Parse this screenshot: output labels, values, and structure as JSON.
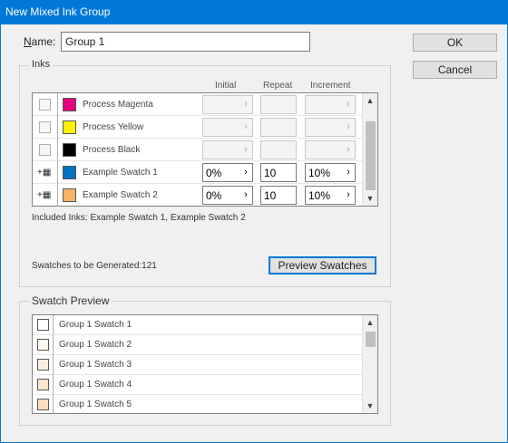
{
  "window": {
    "title": "New Mixed Ink Group"
  },
  "name": {
    "label": "Name:",
    "label_mnemonic": "N",
    "label_rest": "ame:",
    "value": "Group 1"
  },
  "buttons": {
    "ok": "OK",
    "cancel": "Cancel",
    "preview": "Preview Swatches"
  },
  "inks": {
    "title": "Inks",
    "columns": [
      "Initial",
      "Repeat",
      "Increment"
    ],
    "rows": [
      {
        "name": "Process Magenta",
        "color": "#e6007e",
        "included": false,
        "initial": "",
        "repeat": "",
        "increment": ""
      },
      {
        "name": "Process Yellow",
        "color": "#fff200",
        "included": false,
        "initial": "",
        "repeat": "",
        "increment": ""
      },
      {
        "name": "Process Black",
        "color": "#000000",
        "included": false,
        "initial": "",
        "repeat": "",
        "increment": ""
      },
      {
        "name": "Example Swatch 1",
        "color": "#0070c0",
        "included": true,
        "initial": "0%",
        "repeat": "10",
        "increment": "10%"
      },
      {
        "name": "Example Swatch 2",
        "color": "#f9b36b",
        "included": true,
        "initial": "0%",
        "repeat": "10",
        "increment": "10%"
      }
    ],
    "included_text": "Included Inks: Example Swatch 1, Example Swatch 2",
    "generated_text": "Swatches to be Generated:121"
  },
  "swatch_preview": {
    "title": "Swatch Preview",
    "items": [
      {
        "name": "Group 1 Swatch 1",
        "color": "#ffffff"
      },
      {
        "name": "Group 1 Swatch 2",
        "color": "#fef6ee"
      },
      {
        "name": "Group 1 Swatch 3",
        "color": "#feeedf"
      },
      {
        "name": "Group 1 Swatch 4",
        "color": "#fde5cf"
      },
      {
        "name": "Group 1 Swatch 5",
        "color": "#fdddc0"
      }
    ]
  }
}
